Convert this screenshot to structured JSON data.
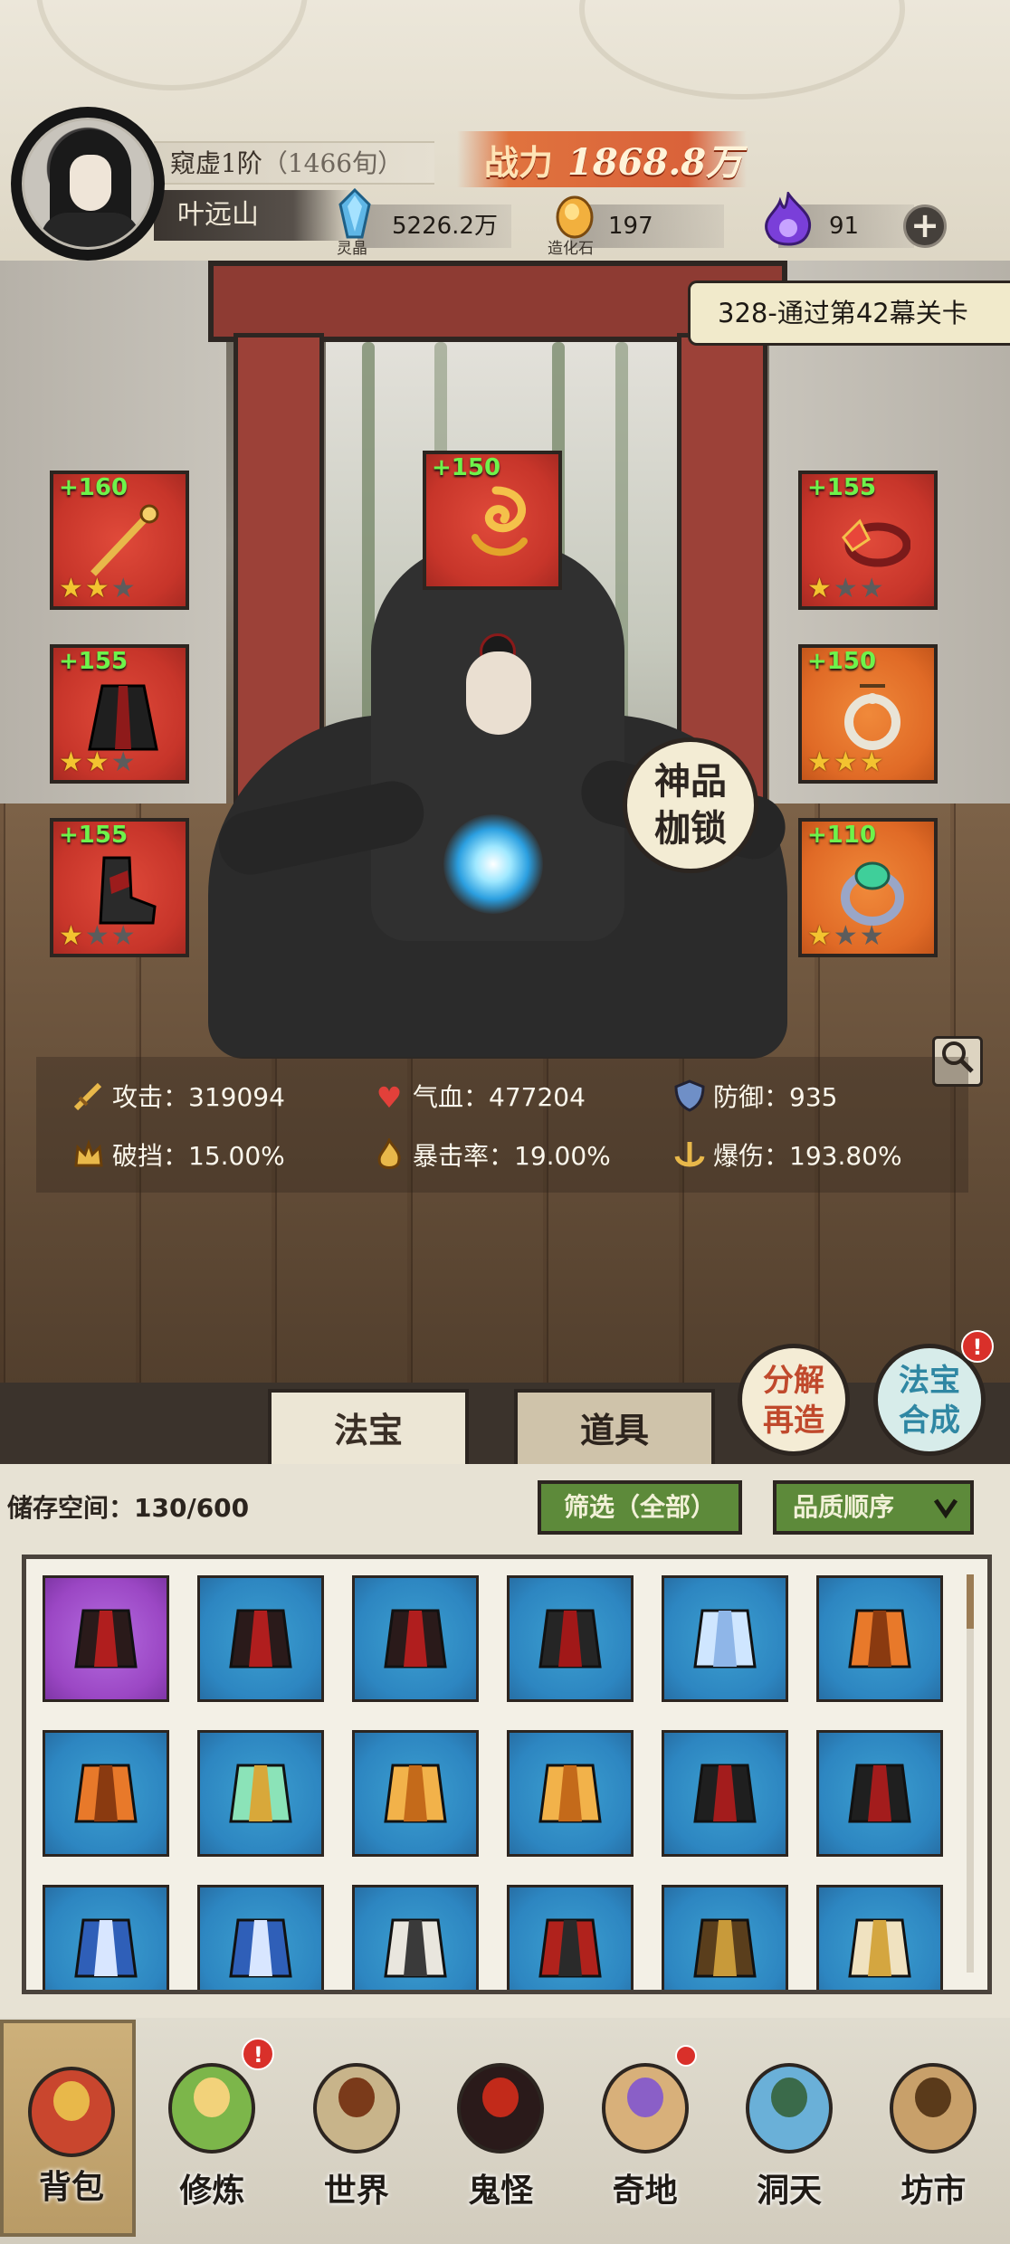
{
  "player": {
    "realm": "窥虚1阶",
    "lifespan": "（1466旬）",
    "name": "叶远山",
    "power_label": "战力",
    "power_value": "1868.8万"
  },
  "resources": [
    {
      "caption": "灵晶",
      "value": "5226.2万",
      "icon": "blue-crystal-icon"
    },
    {
      "caption": "造化石",
      "value": "197",
      "icon": "golden-stone-icon"
    },
    {
      "caption": "",
      "value": "91",
      "icon": "purple-flame-icon"
    }
  ],
  "quest": {
    "text": "328-通过第42幕关卡"
  },
  "equipment": {
    "left": [
      {
        "level": "+160",
        "stars": 2,
        "icon": "golden-staff-icon"
      },
      {
        "level": "+155",
        "stars": 2,
        "icon": "dark-robe-icon"
      },
      {
        "level": "+155",
        "stars": 1,
        "icon": "dark-boots-icon"
      }
    ],
    "top": {
      "level": "+150",
      "icon": "golden-dragon-icon"
    },
    "right": [
      {
        "level": "+155",
        "stars": 1,
        "icon": "crown-headband-icon"
      },
      {
        "level": "+150",
        "stars": 3,
        "icon": "jade-pendant-icon"
      },
      {
        "level": "+110",
        "stars": 1,
        "icon": "emerald-ring-icon"
      }
    ]
  },
  "shackle_button": {
    "line1": "神品",
    "line2": "枷锁"
  },
  "stats": [
    {
      "label": "攻击：",
      "value": "319094",
      "icon": "sword-icon"
    },
    {
      "label": "气血：",
      "value": "477204",
      "icon": "heart-icon"
    },
    {
      "label": "防御：",
      "value": "935",
      "icon": "shield-icon"
    },
    {
      "label": "破挡：",
      "value": "15.00%",
      "icon": "crown-break-icon"
    },
    {
      "label": "暴击率：",
      "value": "19.00%",
      "icon": "crit-flame-icon"
    },
    {
      "label": "爆伤：",
      "value": "193.80%",
      "icon": "anchor-blast-icon"
    }
  ],
  "actions": {
    "decompose": {
      "line1": "分解",
      "line2": "再造"
    },
    "synthesize": {
      "line1": "法宝",
      "line2": "合成",
      "badge": "!"
    }
  },
  "tabs": [
    {
      "label": "法宝",
      "active": true
    },
    {
      "label": "道具",
      "active": false
    }
  ],
  "storage": {
    "label": "储存空间：",
    "used": "130/600",
    "filter_label": "筛选（全部）",
    "sort_label": "品质顺序"
  },
  "inventory": [
    {
      "icon": "dark-dagger-icon",
      "quality": "purple"
    },
    {
      "icon": "dark-dagger-icon",
      "quality": "blue"
    },
    {
      "icon": "dark-dagger-icon",
      "quality": "blue"
    },
    {
      "icon": "dark-shuriken-icon",
      "quality": "blue"
    },
    {
      "icon": "ice-sword-icon",
      "quality": "blue"
    },
    {
      "icon": "fire-axe-icon",
      "quality": "blue"
    },
    {
      "icon": "fire-axe-icon",
      "quality": "blue"
    },
    {
      "icon": "jade-mirror-icon",
      "quality": "blue"
    },
    {
      "icon": "golden-armor-icon",
      "quality": "blue"
    },
    {
      "icon": "golden-armor-icon",
      "quality": "blue"
    },
    {
      "icon": "dark-robe-icon",
      "quality": "blue"
    },
    {
      "icon": "dark-robe-icon",
      "quality": "blue"
    },
    {
      "icon": "blue-armor-icon",
      "quality": "blue"
    },
    {
      "icon": "blue-armor-icon",
      "quality": "blue"
    },
    {
      "icon": "white-robe-icon",
      "quality": "blue"
    },
    {
      "icon": "red-helmet-icon",
      "quality": "blue"
    },
    {
      "icon": "brown-robe-icon",
      "quality": "blue"
    },
    {
      "icon": "gold-plate-armor-icon",
      "quality": "blue"
    }
  ],
  "nav": [
    {
      "label": "背包",
      "icon": "backpack-icon",
      "active": true,
      "badge": ""
    },
    {
      "label": "修炼",
      "icon": "lotus-icon",
      "active": false,
      "badge": "!"
    },
    {
      "label": "世界",
      "icon": "scroll-map-icon",
      "active": false,
      "badge": ""
    },
    {
      "label": "鬼怪",
      "icon": "demon-egg-icon",
      "active": false,
      "badge": ""
    },
    {
      "label": "奇地",
      "icon": "floating-island-icon",
      "active": false,
      "badge": "dot"
    },
    {
      "label": "洞天",
      "icon": "portal-gate-icon",
      "active": false,
      "badge": ""
    },
    {
      "label": "坊市",
      "icon": "market-stall-icon",
      "active": false,
      "badge": ""
    }
  ],
  "colors": {
    "accent": "#e0733e",
    "equip_red": "#c7352a",
    "equip_orange": "#e06a26",
    "slot_blue": "#2d86c1",
    "slot_purple": "#9b47c4",
    "level_green": "#6ef34b",
    "button_green": "#5d8a3a"
  }
}
